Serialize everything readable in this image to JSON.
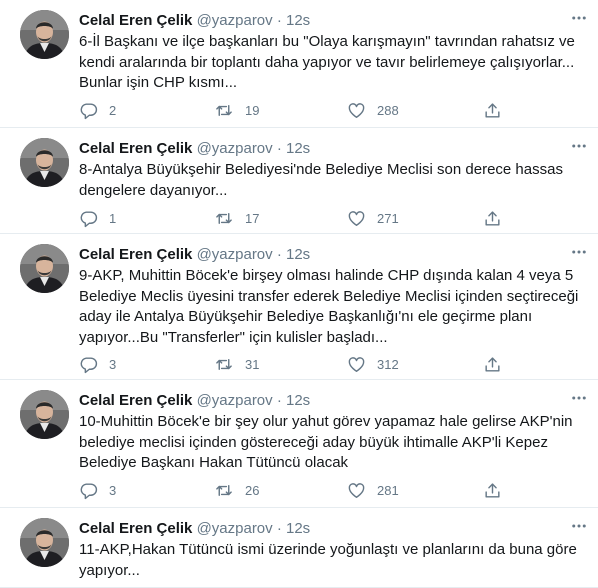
{
  "tweets": [
    {
      "name": "Celal Eren Çelik",
      "handle": "@yazparov",
      "separator": "·",
      "time": "12s",
      "text": "6-İl Başkanı ve ilçe başkanları bu \"Olaya karışmayın\" tavrından rahatsız ve kendi aralarında bir toplantı daha yapıyor ve tavır belirlemeye çalışıyorlar... Bunlar işin CHP kısmı...",
      "replies": "2",
      "retweets": "19",
      "likes": "288"
    },
    {
      "name": "Celal Eren Çelik",
      "handle": "@yazparov",
      "separator": "·",
      "time": "12s",
      "text": "8-Antalya Büyükşehir Belediyesi'nde Belediye Meclisi son derece hassas dengelere dayanıyor...",
      "replies": "1",
      "retweets": "17",
      "likes": "271"
    },
    {
      "name": "Celal Eren Çelik",
      "handle": "@yazparov",
      "separator": "·",
      "time": "12s",
      "text": "9-AKP, Muhittin Böcek'e birşey olması halinde CHP dışında kalan 4 veya 5 Belediye Meclis üyesini transfer ederek Belediye Meclisi içinden seçtireceği aday ile Antalya Büyükşehir Belediye Başkanlığı'nı ele geçirme planı yapıyor...Bu \"Transferler\" için kulisler başladı...",
      "replies": "3",
      "retweets": "31",
      "likes": "312"
    },
    {
      "name": "Celal Eren Çelik",
      "handle": "@yazparov",
      "separator": "·",
      "time": "12s",
      "text": "10-Muhittin Böcek'e bir şey olur yahut görev yapamaz hale gelirse AKP'nin belediye meclisi içinden göstereceği aday büyük ihtimalle AKP'li Kepez Belediye Başkanı  Hakan Tütüncü olacak",
      "replies": "3",
      "retweets": "26",
      "likes": "281"
    },
    {
      "name": "Celal Eren Çelik",
      "handle": "@yazparov",
      "separator": "·",
      "time": "12s",
      "text": "11-AKP,Hakan Tütüncü ismi üzerinde yoğunlaştı ve planlarını da buna göre yapıyor...",
      "replies": "",
      "retweets": "",
      "likes": ""
    }
  ],
  "icons": {
    "more": "more-horizontal-icon",
    "reply": "reply-icon",
    "retweet": "retweet-icon",
    "like": "heart-icon",
    "share": "share-icon"
  },
  "colors": {
    "text": "#14171a",
    "secondary": "#657786",
    "divider": "#e6ecf0"
  }
}
